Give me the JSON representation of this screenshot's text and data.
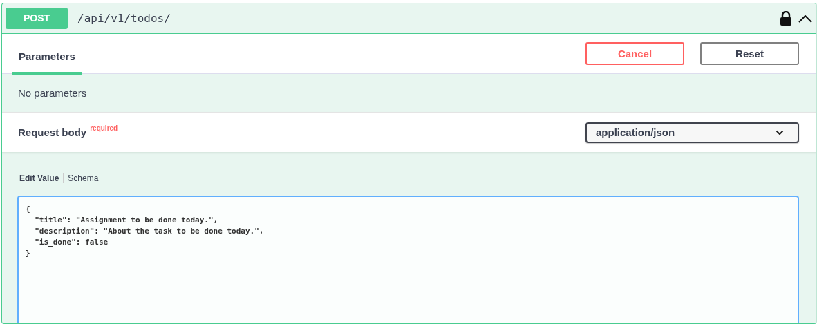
{
  "operation": {
    "method": "POST",
    "path": "/api/v1/todos/",
    "locked": true,
    "expanded": true
  },
  "tabs": [
    {
      "label": "Parameters",
      "selected": true
    }
  ],
  "buttons": [
    {
      "label": "Cancel",
      "kind": "danger"
    },
    {
      "label": "Reset",
      "kind": "plain"
    }
  ],
  "parameters_text": "No parameters",
  "request_body": {
    "label": "Request body",
    "required_label": "required",
    "content_type": "application/json"
  },
  "editor_tabs": [
    {
      "label": "Edit Value",
      "selected": true
    },
    {
      "label": "Schema",
      "selected": false
    }
  ],
  "editor": {
    "value": "{\n  \"title\": \"Assignment to be done today.\",\n  \"description\": \"About the task to be done today.\",\n  \"is_done\": false\n}"
  }
}
